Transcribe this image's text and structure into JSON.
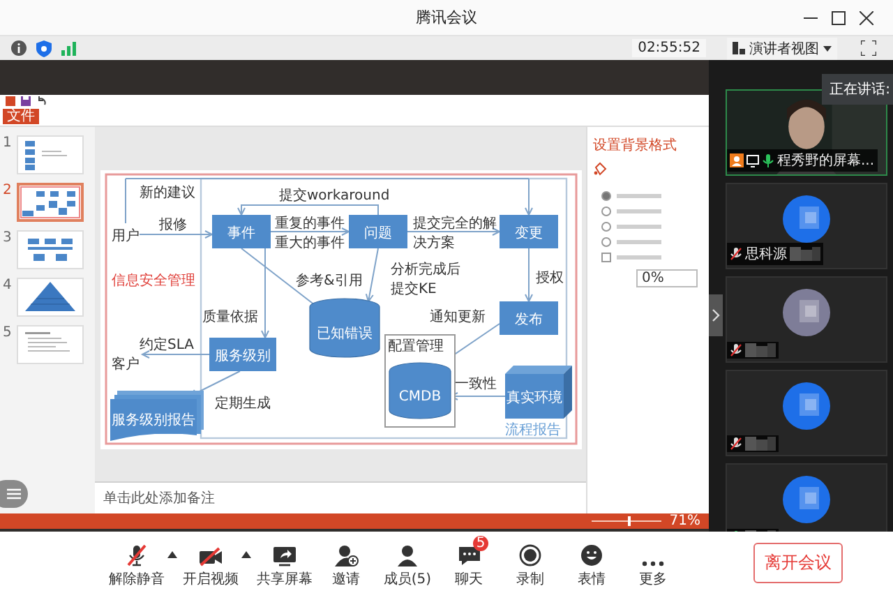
{
  "window": {
    "title": "腾讯会议"
  },
  "toolbar": {
    "timer": "02:55:52",
    "view_button": "演讲者视图"
  },
  "speaking_tooltip": "正在讲话:",
  "shared_screen": {
    "file_tab": "文件",
    "slides": [
      {
        "number": "1",
        "selected": false,
        "kind": "flow"
      },
      {
        "number": "2",
        "selected": true,
        "kind": "diagram"
      },
      {
        "number": "3",
        "selected": false,
        "kind": "tree"
      },
      {
        "number": "4",
        "selected": false,
        "kind": "pyramid"
      },
      {
        "number": "5",
        "selected": false,
        "kind": "text"
      }
    ],
    "diagram": {
      "boxes": [
        "事件",
        "问题",
        "变更",
        "发布",
        "服务级别"
      ],
      "databases": [
        "已知错误",
        "CMDB"
      ],
      "group_label": "配置管理",
      "environment": "真实环境",
      "report": "服务级别报告",
      "labels": [
        {
          "lines": [
            "新的建议"
          ],
          "kind": "note"
        },
        {
          "lines": [
            "用户"
          ],
          "kind": "note"
        },
        {
          "lines": [
            "报修"
          ],
          "kind": "note"
        },
        {
          "lines": [
            "提交workaround"
          ],
          "kind": "note"
        },
        {
          "lines": [
            "重复的事件",
            "重大的事件"
          ],
          "kind": "note"
        },
        {
          "lines": [
            "提交完全的解",
            "决方案"
          ],
          "kind": "note"
        },
        {
          "lines": [
            "信息安全管理"
          ],
          "kind": "title"
        },
        {
          "lines": [
            "参考&引用"
          ],
          "kind": "note"
        },
        {
          "lines": [
            "分析完成后",
            "提交KE"
          ],
          "kind": "note"
        },
        {
          "lines": [
            "授权"
          ],
          "kind": "note"
        },
        {
          "lines": [
            "质量依据"
          ],
          "kind": "note"
        },
        {
          "lines": [
            "通知更新"
          ],
          "kind": "note"
        },
        {
          "lines": [
            "约定SLA"
          ],
          "kind": "note"
        },
        {
          "lines": [
            "客户"
          ],
          "kind": "note"
        },
        {
          "lines": [
            "一致性"
          ],
          "kind": "note"
        },
        {
          "lines": [
            "定期生成"
          ],
          "kind": "note"
        },
        {
          "lines": [
            "流程报告"
          ],
          "kind": "caption"
        }
      ]
    },
    "notes_placeholder": "单击此处添加备注",
    "format_pane": {
      "title": "设置背景格式",
      "options": [
        {
          "kind": "radio",
          "selected": true
        },
        {
          "kind": "radio",
          "selected": false
        },
        {
          "kind": "radio",
          "selected": false
        },
        {
          "kind": "radio",
          "selected": false
        },
        {
          "kind": "checkbox",
          "checked": false
        }
      ],
      "transparency": "0%"
    },
    "status_bar": {
      "zoom": {
        "level": 0.55,
        "reading": "71%"
      }
    }
  },
  "participants": [
    {
      "kind": "video",
      "name": "程秀野的屏幕...",
      "speaking": true,
      "host": true,
      "muted": false
    },
    {
      "kind": "avatar",
      "name": "思科源",
      "speaking": false,
      "host": false,
      "muted": true,
      "color": "#1e6fe8"
    },
    {
      "kind": "avatar",
      "speaking": false,
      "host": false,
      "muted": true,
      "color": "#7e7d98"
    },
    {
      "kind": "avatar",
      "speaking": false,
      "host": false,
      "muted": true,
      "color": "#1e6fe8"
    },
    {
      "kind": "avatar",
      "speaking": false,
      "host": false,
      "muted": false,
      "color": "#1e6fe8"
    }
  ],
  "controls": [
    {
      "kind": "mic",
      "label": "解除静音",
      "off": true,
      "has_menu": true
    },
    {
      "kind": "video",
      "label": "开启视频",
      "off": true,
      "has_menu": true
    },
    {
      "kind": "share",
      "label": "共享屏幕",
      "off": false,
      "has_menu": false
    },
    {
      "kind": "invite",
      "label": "邀请",
      "off": false,
      "has_menu": false
    },
    {
      "kind": "members",
      "label": "成员(5)",
      "off": false,
      "has_menu": false
    },
    {
      "kind": "chat",
      "label": "聊天",
      "off": false,
      "has_menu": false,
      "badge": "5"
    },
    {
      "kind": "record",
      "label": "录制",
      "off": false,
      "has_menu": false
    },
    {
      "kind": "emoji",
      "label": "表情",
      "off": false,
      "has_menu": false
    },
    {
      "kind": "more",
      "label": "更多",
      "off": false,
      "has_menu": false
    }
  ],
  "leave_button": "离开会议"
}
